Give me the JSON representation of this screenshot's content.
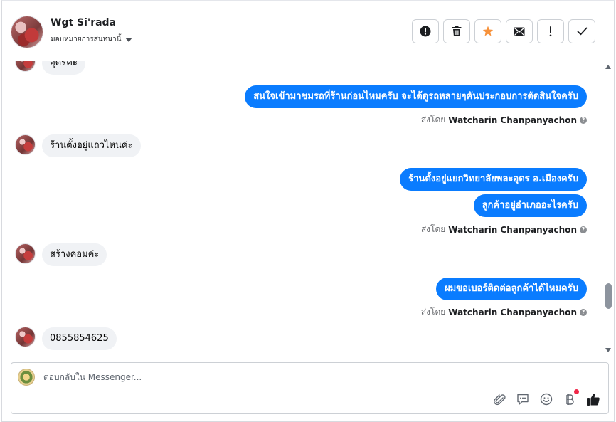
{
  "header": {
    "name": "Wgt Si'rada",
    "assign_label": "มอบหมายการสนทนานี้",
    "actions": [
      {
        "name": "spam-button",
        "icon": "alert-circle-icon"
      },
      {
        "name": "delete-button",
        "icon": "trash-icon"
      },
      {
        "name": "star-button",
        "icon": "star-icon",
        "color": "#f7923b"
      },
      {
        "name": "mark-unread-button",
        "icon": "envelope-icon"
      },
      {
        "name": "follow-up-button",
        "icon": "exclamation-icon"
      },
      {
        "name": "mark-done-button",
        "icon": "check-icon"
      }
    ]
  },
  "messages": [
    {
      "side": "in",
      "text": "อุดรคะ"
    },
    {
      "side": "out",
      "text": "สนใจเข้ามาชมรถที่ร้านก่อนไหมครับ จะได้ดูรถหลายๆคันประกอบการตัดสินใจครับ"
    },
    {
      "side": "meta",
      "prefix": "ส่งโดย",
      "author": "Watcharin Chanpanyachon"
    },
    {
      "side": "in",
      "text": "ร้านตั้งอยู่แถวไหนค่ะ"
    },
    {
      "side": "out",
      "text": "ร้านตั้งอยู่แยกวิทยาลัยพละอุดร อ.เมืองครับ"
    },
    {
      "side": "out",
      "text": "ลูกค้าอยู่อำเภออะไรครับ"
    },
    {
      "side": "meta",
      "prefix": "ส่งโดย",
      "author": "Watcharin Chanpanyachon"
    },
    {
      "side": "in",
      "text": "สร้างคอมค่ะ"
    },
    {
      "side": "out",
      "text": "ผมขอเบอร์ติดต่อลูกค้าได้ไหมครับ"
    },
    {
      "side": "meta",
      "prefix": "ส่งโดย",
      "author": "Watcharin Chanpanyachon"
    },
    {
      "side": "in",
      "text": "0855854625"
    }
  ],
  "composer": {
    "placeholder": "ตอบกลับใน Messenger...",
    "tools": [
      "attachment-icon",
      "saved-reply-icon",
      "emoji-icon",
      "payment-icon",
      "like-icon"
    ]
  },
  "colors": {
    "outgoing_bubble": "#0a7cff",
    "incoming_bubble": "#f0f2f5",
    "notification_dot": "#f02849"
  }
}
